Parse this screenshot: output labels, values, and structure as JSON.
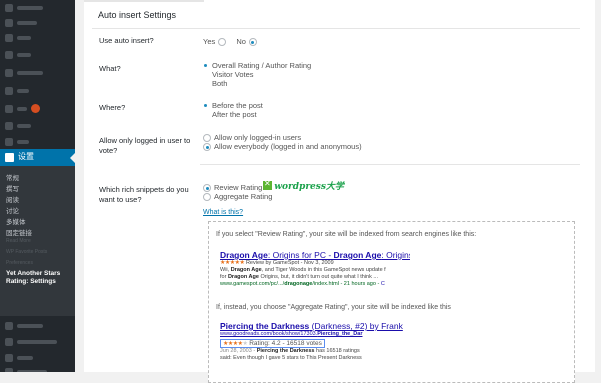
{
  "sidebar": {
    "settings_label": "设置",
    "submenu": [
      "常规",
      "撰写",
      "阅读",
      "讨论",
      "多媒体",
      "固定链接"
    ],
    "submenu_dim": [
      "Read More",
      "WP Favorite Posts",
      "Preferences"
    ],
    "current": "Yet Another Stars Rating: Settings"
  },
  "settings": {
    "title": "Auto insert Settings",
    "auto_insert": {
      "label": "Use auto insert?",
      "yes": "Yes",
      "no": "No",
      "selected": "No"
    },
    "what": {
      "label": "What?",
      "options": [
        "Overall Rating / Author Rating",
        "Visitor Votes",
        "Both"
      ],
      "selected": "Overall Rating / Author Rating"
    },
    "where": {
      "label": "Where?",
      "options": [
        "Before the post",
        "After the post"
      ],
      "selected": "Before the post"
    },
    "logged_in": {
      "label": "Allow only logged in user to vote?",
      "options": [
        "Allow only logged-in users",
        "Allow everybody (logged in and anonymous)"
      ],
      "selected": "Allow everybody (logged in and anonymous)"
    },
    "rich_snippets": {
      "label": "Which rich snippets do you want to use?",
      "options": [
        "Review Rating",
        "Aggregate Rating"
      ],
      "selected": "Review Rating"
    },
    "watermark": "wordpress大学",
    "what_is_this": "What is this?"
  },
  "example": {
    "review_intro": "If you select \"Review Rating\", your site will be indexed from search engines like this:",
    "review": {
      "title_parts": [
        "Dragon Age",
        ": Origins for PC - ",
        "Dragon Age",
        ": Origins PC G"
      ],
      "meta": "Review by GameSpot - Nov 3, 2009",
      "line1_parts": [
        "Wii, ",
        "Dragon Age",
        ", and Tiger Woods in this GameSpot news update f"
      ],
      "line2_parts": [
        "for ",
        "Dragon Age",
        " Origins, but, it didn't turn out quite what I think ..."
      ],
      "url_parts": [
        "www.gamespot.com/pc/.../",
        "dragonage",
        "/index.html - 21 hours ago - ",
        "C"
      ],
      "stars": "★★★★★"
    },
    "aggregate_intro": "If, instead, you choose \"Aggregate Rating\", your site will be indexed like this",
    "aggregate": {
      "title": "Piercing the Darkness",
      "title_rest": " (Darkness, #2) by Frank",
      "url_parts": [
        "www.goodreads.com/book/show/17303.",
        "Piercing_the_Dar"
      ],
      "stars": "★★★★",
      "star_empty": "★",
      "rating_text": "Rating: 4.2 - 16518 votes",
      "line1_parts": [
        "Jun 28, 2003 - ",
        "Piercing the Darkness",
        " has 16518 ratings"
      ],
      "line2": "said: Even though I gave 5 stars to This Present Darkness"
    }
  },
  "colors": {
    "accent": "#0073aa",
    "sidebar": "#23282d",
    "link": "#1a0dab",
    "star": "#e7711b"
  }
}
